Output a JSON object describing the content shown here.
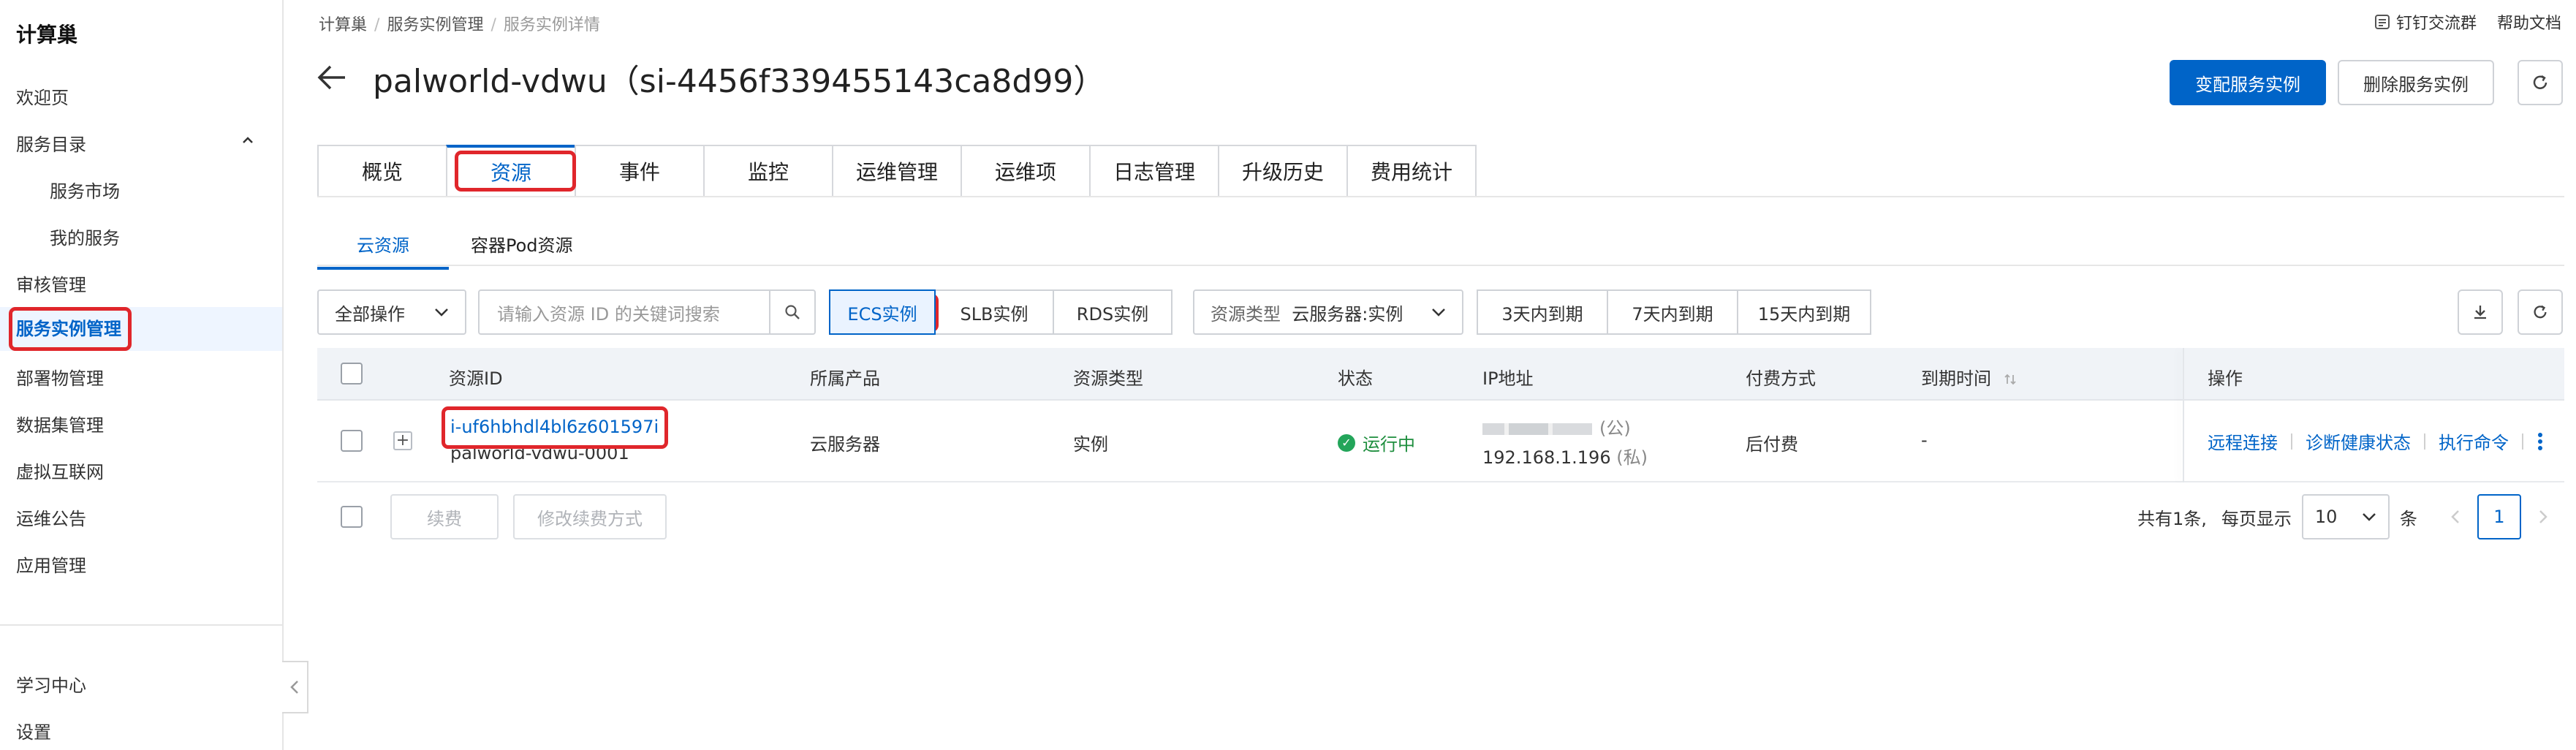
{
  "sidebar": {
    "brand": "计算巢",
    "items": [
      {
        "label": "欢迎页"
      },
      {
        "label": "服务目录"
      },
      {
        "label": "服务市场"
      },
      {
        "label": "我的服务"
      },
      {
        "label": "审核管理"
      },
      {
        "label": "服务实例管理"
      },
      {
        "label": "部署物管理"
      },
      {
        "label": "数据集管理"
      },
      {
        "label": "虚拟互联网"
      },
      {
        "label": "运维公告"
      },
      {
        "label": "应用管理"
      },
      {
        "label": "学习中心"
      },
      {
        "label": "设置"
      }
    ]
  },
  "breadcrumb": [
    "计算巢",
    "服务实例管理",
    "服务实例详情"
  ],
  "top_links": {
    "dingtalk": "钉钉交流群",
    "help": "帮助文档"
  },
  "title": "palworld-vdwu（si-4456f339455143ca8d99）",
  "actions": {
    "change": "变配服务实例",
    "delete": "删除服务实例"
  },
  "tabs": [
    "概览",
    "资源",
    "事件",
    "监控",
    "运维管理",
    "运维项",
    "日志管理",
    "升级历史",
    "费用统计"
  ],
  "subtabs": [
    "云资源",
    "容器Pod资源"
  ],
  "filters": {
    "bulk_action": "全部操作",
    "search_placeholder": "请输入资源 ID 的关键词搜索",
    "instance_types": [
      "ECS实例",
      "SLB实例",
      "RDS实例"
    ],
    "resource_type_label": "资源类型",
    "resource_type_value": "云服务器:实例",
    "expiry": [
      "3天内到期",
      "7天内到期",
      "15天内到期"
    ]
  },
  "table": {
    "headers": [
      "资源ID",
      "所属产品",
      "资源类型",
      "状态",
      "IP地址",
      "付费方式",
      "到期时间",
      "操作"
    ],
    "rows": [
      {
        "resource_id": "i-uf6hbhdl4bl6z601597i",
        "resource_name": "palworld-vdwu-0001",
        "product": "云服务器",
        "type": "实例",
        "status": "运行中",
        "ip_public_suffix": "(公)",
        "ip_private": "192.168.1.196",
        "ip_private_suffix": "(私)",
        "billing": "后付费",
        "expiry": "-",
        "ops": [
          "远程连接",
          "诊断健康状态",
          "执行命令"
        ]
      }
    ]
  },
  "footer": {
    "renew": "续费",
    "change_billing": "修改续费方式",
    "total": "共有1条,",
    "per_page_label": "每页显示",
    "per_page": "10",
    "per_page_unit": "条",
    "current_page": "1"
  },
  "colors": {
    "accent": "#0064c8",
    "highlight": "#e0262b",
    "running": "#23a55a"
  }
}
